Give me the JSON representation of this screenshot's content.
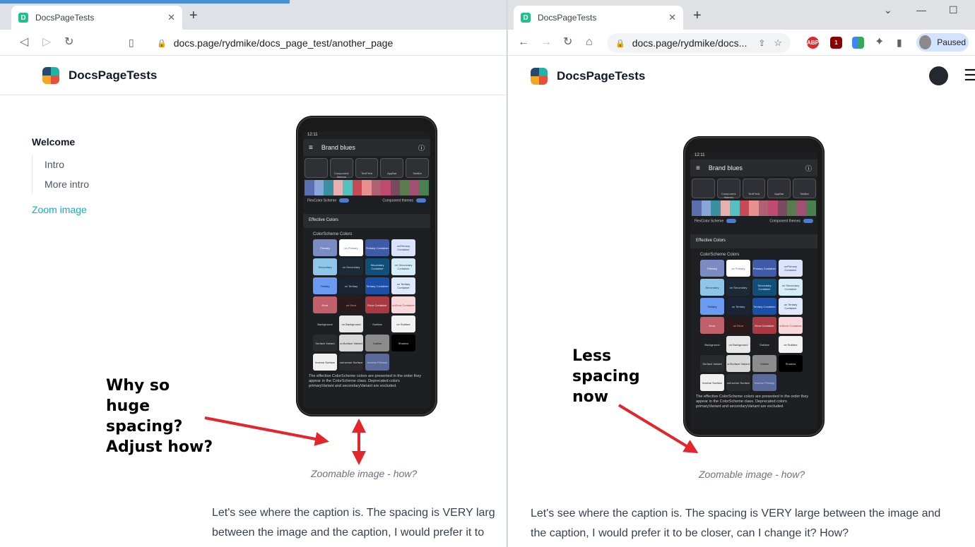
{
  "tab_title": "DocsPageTests",
  "left_window": {
    "url": "docs.page/rydmike/docs_page_test/another_page",
    "sidebar": {
      "heading": "Welcome",
      "items": [
        "Intro",
        "More intro"
      ],
      "active_link": "Zoom image"
    },
    "caption": "Zoomable image - how?",
    "body_line_1": "Let's see where the caption is. The spacing is VERY larg",
    "body_line_2": "between the image and the caption, I would prefer it to",
    "annotation": [
      "Why so",
      "huge",
      "spacing?",
      "Adjust how?"
    ]
  },
  "right_window": {
    "url": "docs.page/rydmike/docs...",
    "profile_label": "Paused",
    "caption": "Zoomable image - how?",
    "body_line_1": "Let's see where the caption is. The spacing is VERY large between the image and",
    "body_line_2": "the caption, I would prefer it to be closer, can I change it? How?",
    "annotation": [
      "Less",
      "spacing",
      "now"
    ]
  },
  "site_title": "DocsPageTests",
  "phone_screen": {
    "time": "12:11",
    "app_title": "Brand blues",
    "tiles": [
      "",
      "Component themes",
      "TextField",
      "AppBar",
      "TabBar"
    ],
    "toggle_left": "FlexColor Scheme",
    "toggle_right": "Component themes",
    "section": "Effective Colors",
    "subsection": "ColorScheme Colors",
    "cells": [
      {
        "label": "Primary",
        "bg": "#7b8cc4",
        "fg": "#ffffff"
      },
      {
        "label": "on Primary",
        "bg": "#ffffff",
        "fg": "#5567a8"
      },
      {
        "label": "Primary Container",
        "bg": "#3e5aa8",
        "fg": "#ffffff"
      },
      {
        "label": "onPrimary Container",
        "bg": "#dbe4fb",
        "fg": "#2a3a6a"
      },
      {
        "label": "Secondary",
        "bg": "#8ec5e8",
        "fg": "#1a3a4a"
      },
      {
        "label": "on Secondary",
        "bg": "#1b2a34",
        "fg": "#cde"
      },
      {
        "label": "Secondary Container",
        "bg": "#0f4f7a",
        "fg": "#e0f0ff"
      },
      {
        "label": "on Secondary Container",
        "bg": "#d6ecf7",
        "fg": "#1a3a4a"
      },
      {
        "label": "Tertiary",
        "bg": "#6a9bf0",
        "fg": "#0a1a3a"
      },
      {
        "label": "on Tertiary",
        "bg": "#1a2434",
        "fg": "#cde"
      },
      {
        "label": "Tertiary Container",
        "bg": "#1b4fa8",
        "fg": "#e6efff"
      },
      {
        "label": "on Tertiary Container",
        "bg": "#dfe9fb",
        "fg": "#1a2a4a"
      },
      {
        "label": "Error",
        "bg": "#c0606a",
        "fg": "#fff"
      },
      {
        "label": "on Error",
        "bg": "#2a1a1c",
        "fg": "#f99"
      },
      {
        "label": "Error Container",
        "bg": "#a83a44",
        "fg": "#fff"
      },
      {
        "label": "onError Container",
        "bg": "#f8d8da",
        "fg": "#a83a44"
      },
      {
        "label": "Background",
        "bg": "#1e1f22",
        "fg": "#ddd"
      },
      {
        "label": "on Background",
        "bg": "#e8e8e8",
        "fg": "#222"
      },
      {
        "label": "Surface",
        "bg": "#1e1f22",
        "fg": "#ddd"
      },
      {
        "label": "on Surface",
        "bg": "#f2f2f2",
        "fg": "#222"
      },
      {
        "label": "Surface Variant",
        "bg": "#2a2b2f",
        "fg": "#ddd"
      },
      {
        "label": "onSurface Variant",
        "bg": "#d8d8d8",
        "fg": "#222"
      },
      {
        "label": "Outline",
        "bg": "#8c8c8c",
        "fg": "#111"
      },
      {
        "label": "Shadow",
        "bg": "#000000",
        "fg": "#ddd"
      },
      {
        "label": "Inverse Surface",
        "bg": "#f0f0f0",
        "fg": "#222"
      },
      {
        "label": "onInverse Surface",
        "bg": "#2a2b2f",
        "fg": "#ddd"
      },
      {
        "label": "Inverse Primary",
        "bg": "#5a6a9a",
        "fg": "#c8d0ee"
      }
    ],
    "footnote": "The effective ColorScheme colors are presented in the order they appear in the ColorScheme class. Deprecated colors primaryVariant and secondaryVariant are excluded."
  },
  "colors": {
    "accent": "#00b4c8",
    "annotation_arrow": "#e3262b"
  }
}
